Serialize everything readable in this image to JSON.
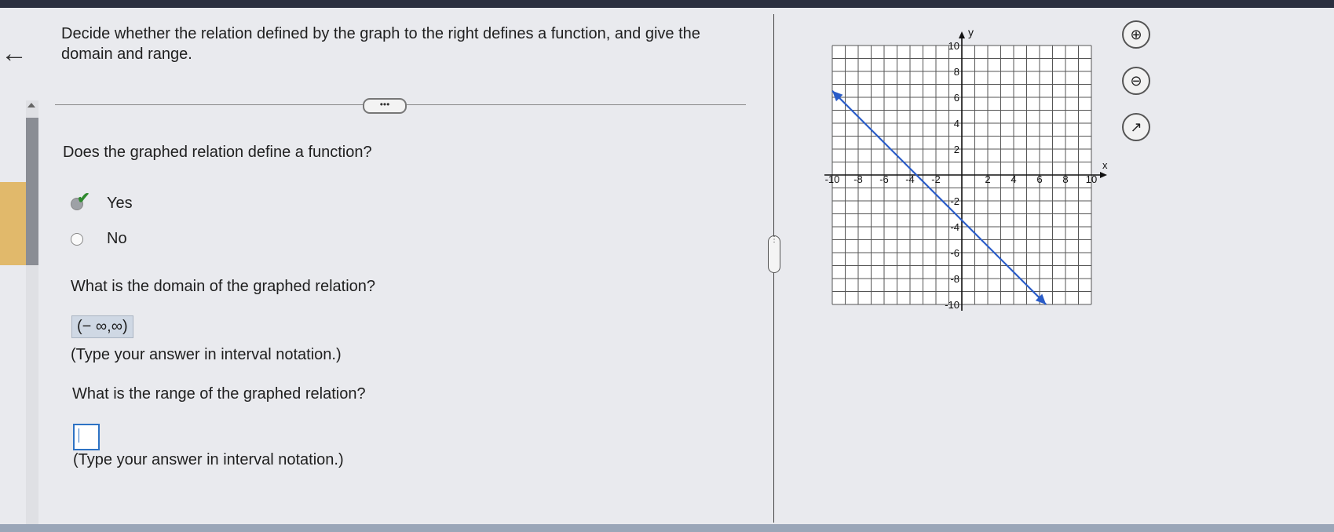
{
  "nav": {
    "back_label": "←"
  },
  "question": {
    "prompt": "Decide whether the relation defined by the graph to the right defines a function, and give the domain and range.",
    "more_label": "•••"
  },
  "q1": {
    "text": "Does the graphed relation define a function?",
    "options": [
      "Yes",
      "No"
    ],
    "selected": "Yes"
  },
  "q2": {
    "text": "What is the domain of the graphed relation?",
    "answer": "(− ∞,∞)",
    "hint": "(Type your answer in interval notation.)"
  },
  "q3": {
    "text": "What is the range of the graphed relation?",
    "answer": "",
    "hint": "(Type your answer in interval notation.)"
  },
  "splitter_label": "⋮",
  "tools": {
    "zoom_in": "⊕",
    "zoom_out": "⊖",
    "popout": "↗"
  },
  "chart_data": {
    "type": "line",
    "xlabel": "x",
    "ylabel": "y",
    "xlim": [
      -10,
      10
    ],
    "ylim": [
      -10,
      10
    ],
    "grid": true,
    "x_ticks": [
      -10,
      -8,
      -6,
      -4,
      -2,
      2,
      4,
      6,
      8,
      10
    ],
    "y_ticks": [
      10,
      8,
      6,
      4,
      2,
      -2,
      -4,
      -6,
      -8,
      -10
    ],
    "x_tick_labels": [
      "-10",
      "-8",
      "-6",
      "-4",
      "-2",
      "2",
      "4",
      "6",
      "8",
      "10"
    ],
    "y_tick_labels": [
      "10",
      "8",
      "6",
      "4",
      "2",
      "-2",
      "-4",
      "-6",
      "-8",
      "-10"
    ],
    "series": [
      {
        "x": [
          -10,
          6.5
        ],
        "y": [
          6.5,
          -10
        ],
        "arrows": "both",
        "color": "#2a5cc8"
      }
    ]
  }
}
